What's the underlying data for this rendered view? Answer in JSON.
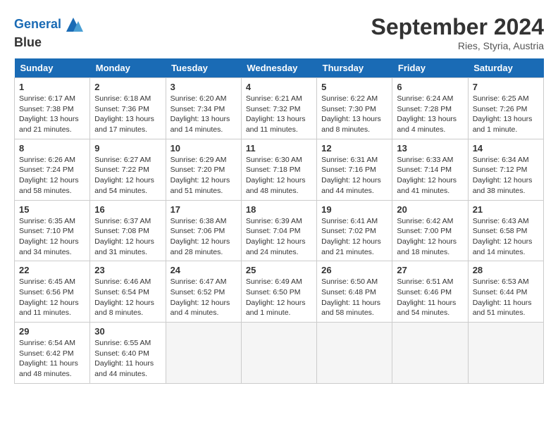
{
  "header": {
    "logo_line1": "General",
    "logo_line2": "Blue",
    "month": "September 2024",
    "location": "Ries, Styria, Austria"
  },
  "weekdays": [
    "Sunday",
    "Monday",
    "Tuesday",
    "Wednesday",
    "Thursday",
    "Friday",
    "Saturday"
  ],
  "weeks": [
    [
      {
        "day": "1",
        "sunrise": "6:17 AM",
        "sunset": "7:38 PM",
        "daylight": "13 hours and 21 minutes."
      },
      {
        "day": "2",
        "sunrise": "6:18 AM",
        "sunset": "7:36 PM",
        "daylight": "13 hours and 17 minutes."
      },
      {
        "day": "3",
        "sunrise": "6:20 AM",
        "sunset": "7:34 PM",
        "daylight": "13 hours and 14 minutes."
      },
      {
        "day": "4",
        "sunrise": "6:21 AM",
        "sunset": "7:32 PM",
        "daylight": "13 hours and 11 minutes."
      },
      {
        "day": "5",
        "sunrise": "6:22 AM",
        "sunset": "7:30 PM",
        "daylight": "13 hours and 8 minutes."
      },
      {
        "day": "6",
        "sunrise": "6:24 AM",
        "sunset": "7:28 PM",
        "daylight": "13 hours and 4 minutes."
      },
      {
        "day": "7",
        "sunrise": "6:25 AM",
        "sunset": "7:26 PM",
        "daylight": "13 hours and 1 minute."
      }
    ],
    [
      {
        "day": "8",
        "sunrise": "6:26 AM",
        "sunset": "7:24 PM",
        "daylight": "12 hours and 58 minutes."
      },
      {
        "day": "9",
        "sunrise": "6:27 AM",
        "sunset": "7:22 PM",
        "daylight": "12 hours and 54 minutes."
      },
      {
        "day": "10",
        "sunrise": "6:29 AM",
        "sunset": "7:20 PM",
        "daylight": "12 hours and 51 minutes."
      },
      {
        "day": "11",
        "sunrise": "6:30 AM",
        "sunset": "7:18 PM",
        "daylight": "12 hours and 48 minutes."
      },
      {
        "day": "12",
        "sunrise": "6:31 AM",
        "sunset": "7:16 PM",
        "daylight": "12 hours and 44 minutes."
      },
      {
        "day": "13",
        "sunrise": "6:33 AM",
        "sunset": "7:14 PM",
        "daylight": "12 hours and 41 minutes."
      },
      {
        "day": "14",
        "sunrise": "6:34 AM",
        "sunset": "7:12 PM",
        "daylight": "12 hours and 38 minutes."
      }
    ],
    [
      {
        "day": "15",
        "sunrise": "6:35 AM",
        "sunset": "7:10 PM",
        "daylight": "12 hours and 34 minutes."
      },
      {
        "day": "16",
        "sunrise": "6:37 AM",
        "sunset": "7:08 PM",
        "daylight": "12 hours and 31 minutes."
      },
      {
        "day": "17",
        "sunrise": "6:38 AM",
        "sunset": "7:06 PM",
        "daylight": "12 hours and 28 minutes."
      },
      {
        "day": "18",
        "sunrise": "6:39 AM",
        "sunset": "7:04 PM",
        "daylight": "12 hours and 24 minutes."
      },
      {
        "day": "19",
        "sunrise": "6:41 AM",
        "sunset": "7:02 PM",
        "daylight": "12 hours and 21 minutes."
      },
      {
        "day": "20",
        "sunrise": "6:42 AM",
        "sunset": "7:00 PM",
        "daylight": "12 hours and 18 minutes."
      },
      {
        "day": "21",
        "sunrise": "6:43 AM",
        "sunset": "6:58 PM",
        "daylight": "12 hours and 14 minutes."
      }
    ],
    [
      {
        "day": "22",
        "sunrise": "6:45 AM",
        "sunset": "6:56 PM",
        "daylight": "12 hours and 11 minutes."
      },
      {
        "day": "23",
        "sunrise": "6:46 AM",
        "sunset": "6:54 PM",
        "daylight": "12 hours and 8 minutes."
      },
      {
        "day": "24",
        "sunrise": "6:47 AM",
        "sunset": "6:52 PM",
        "daylight": "12 hours and 4 minutes."
      },
      {
        "day": "25",
        "sunrise": "6:49 AM",
        "sunset": "6:50 PM",
        "daylight": "12 hours and 1 minute."
      },
      {
        "day": "26",
        "sunrise": "6:50 AM",
        "sunset": "6:48 PM",
        "daylight": "11 hours and 58 minutes."
      },
      {
        "day": "27",
        "sunrise": "6:51 AM",
        "sunset": "6:46 PM",
        "daylight": "11 hours and 54 minutes."
      },
      {
        "day": "28",
        "sunrise": "6:53 AM",
        "sunset": "6:44 PM",
        "daylight": "11 hours and 51 minutes."
      }
    ],
    [
      {
        "day": "29",
        "sunrise": "6:54 AM",
        "sunset": "6:42 PM",
        "daylight": "11 hours and 48 minutes."
      },
      {
        "day": "30",
        "sunrise": "6:55 AM",
        "sunset": "6:40 PM",
        "daylight": "11 hours and 44 minutes."
      },
      null,
      null,
      null,
      null,
      null
    ]
  ]
}
